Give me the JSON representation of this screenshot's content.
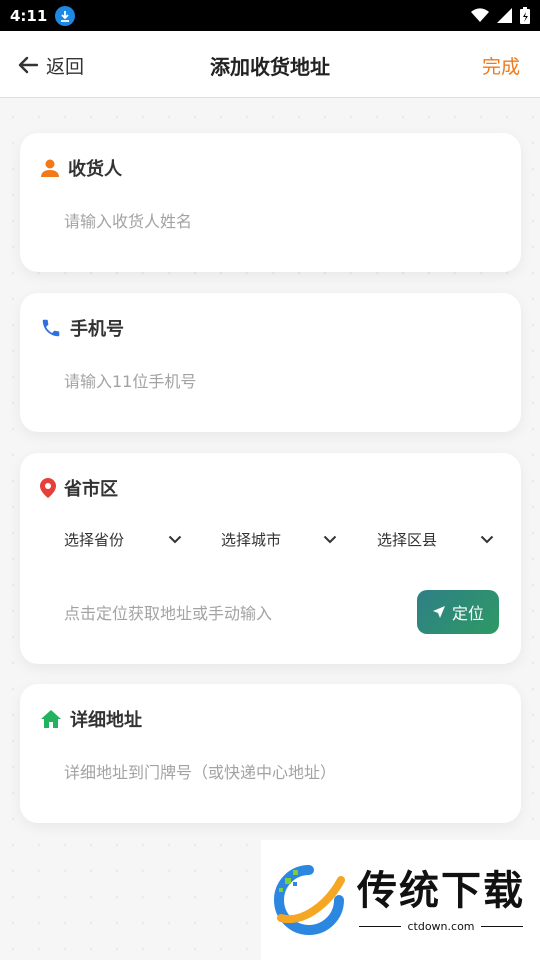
{
  "status": {
    "time": "4:11"
  },
  "header": {
    "back_label": "返回",
    "title": "添加收货地址",
    "done_label": "完成"
  },
  "receiver": {
    "title": "收货人",
    "placeholder": "请输入收货人姓名"
  },
  "phone": {
    "title": "手机号",
    "placeholder": "请输入11位手机号"
  },
  "region": {
    "title": "省市区",
    "province": "选择省份",
    "city": "选择城市",
    "district": "选择区县",
    "placeholder": "点击定位获取地址或手动输入",
    "locate_label": "定位"
  },
  "detail": {
    "title": "详细地址",
    "placeholder": "详细地址到门牌号（或快递中心地址）"
  },
  "watermark": {
    "title": "传统下载",
    "site": "ctdown.com"
  },
  "colors": {
    "accent": "#f07a1a",
    "person": "#f07a1a",
    "phone": "#2f6fe0",
    "pin": "#e5413a",
    "home": "#22b35e"
  }
}
